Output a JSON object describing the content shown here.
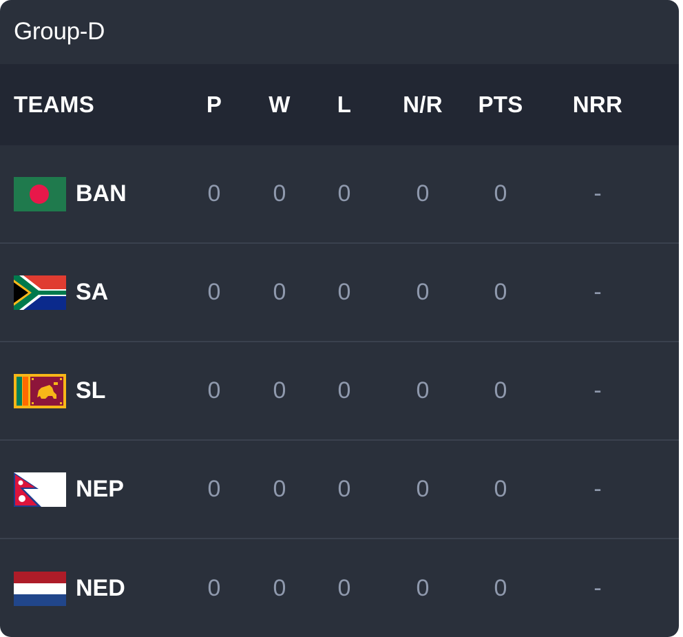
{
  "group": {
    "title": "Group-D"
  },
  "table": {
    "headers": {
      "teams": "TEAMS",
      "p": "P",
      "w": "W",
      "l": "L",
      "nr": "N/R",
      "pts": "PTS",
      "nrr": "NRR"
    },
    "rows": [
      {
        "team": "BAN",
        "flag": "bangladesh-flag-icon",
        "p": "0",
        "w": "0",
        "l": "0",
        "nr": "0",
        "pts": "0",
        "nrr": "-"
      },
      {
        "team": "SA",
        "flag": "south-africa-flag-icon",
        "p": "0",
        "w": "0",
        "l": "0",
        "nr": "0",
        "pts": "0",
        "nrr": "-"
      },
      {
        "team": "SL",
        "flag": "sri-lanka-flag-icon",
        "p": "0",
        "w": "0",
        "l": "0",
        "nr": "0",
        "pts": "0",
        "nrr": "-"
      },
      {
        "team": "NEP",
        "flag": "nepal-flag-icon",
        "p": "0",
        "w": "0",
        "l": "0",
        "nr": "0",
        "pts": "0",
        "nrr": "-"
      },
      {
        "team": "NED",
        "flag": "netherlands-flag-icon",
        "p": "0",
        "w": "0",
        "l": "0",
        "nr": "0",
        "pts": "0",
        "nrr": "-"
      }
    ]
  },
  "colors": {
    "card_bg": "#2a303b",
    "header_bg": "#222733",
    "row_divider": "#3a414e",
    "stat_text": "#8f99ad",
    "team_text": "#ffffff"
  }
}
